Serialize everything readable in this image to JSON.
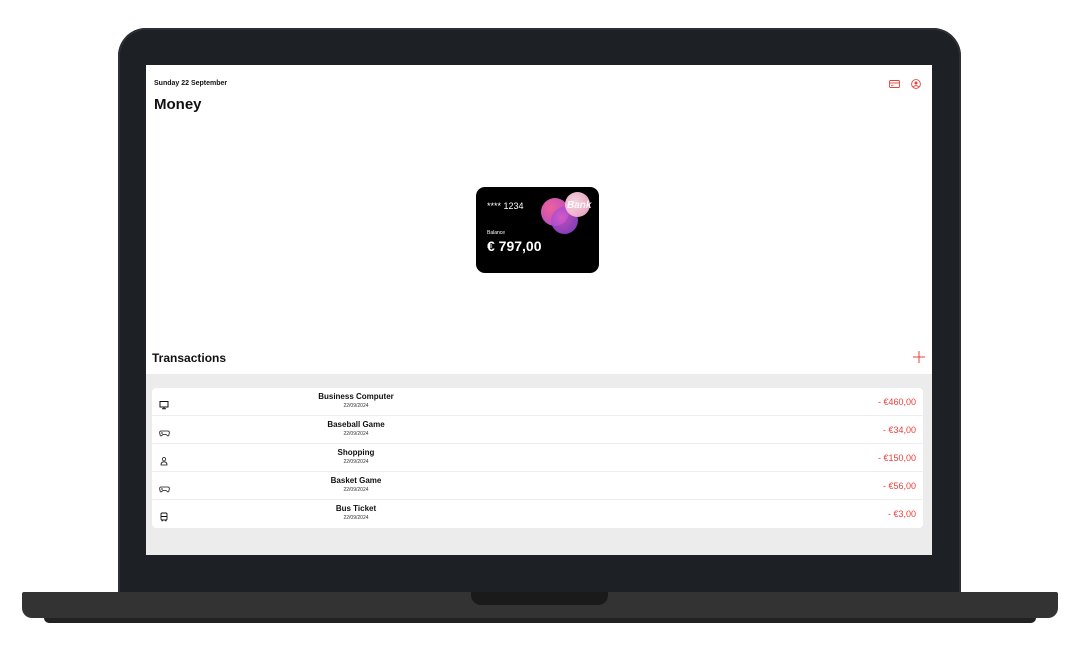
{
  "header": {
    "date": "Sunday 22 September",
    "title": "Money"
  },
  "card": {
    "number": "**** 1234",
    "brand": "Bank",
    "balance_label": "Balance",
    "balance": "€ 797,00"
  },
  "transactions": {
    "title": "Transactions",
    "items": [
      {
        "name": "Business Computer",
        "date": "22/09/2024",
        "amount": "- €460,00",
        "icon": "computer-icon"
      },
      {
        "name": "Baseball Game",
        "date": "22/09/2024",
        "amount": "- €34,00",
        "icon": "gamepad-icon"
      },
      {
        "name": "Shopping",
        "date": "22/09/2024",
        "amount": "- €150,00",
        "icon": "person-icon"
      },
      {
        "name": "Basket Game",
        "date": "22/09/2024",
        "amount": "- €56,00",
        "icon": "gamepad-icon"
      },
      {
        "name": "Bus Ticket",
        "date": "22/09/2024",
        "amount": "- €3,00",
        "icon": "bus-icon"
      }
    ]
  },
  "colors": {
    "accent": "#e8403a",
    "card_bg": "#000000",
    "list_bg": "#ececec"
  }
}
